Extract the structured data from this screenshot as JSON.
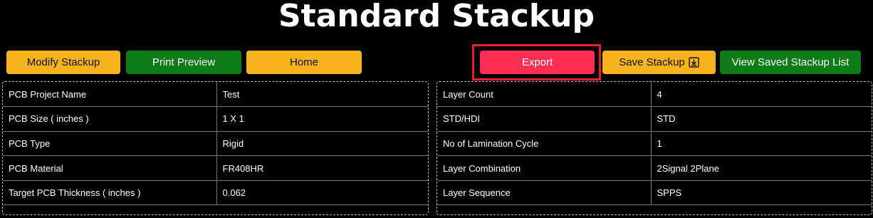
{
  "page_title": "Standard Stackup",
  "buttons": {
    "modify": "Modify Stackup",
    "print_preview": "Print Preview",
    "home": "Home",
    "export": "Export",
    "save": "Save Stackup",
    "view_saved": "View Saved Stackup List"
  },
  "colors": {
    "yellow": "#f5b31c",
    "green": "#0d7c16",
    "red": "#ff2e57",
    "highlight": "#e4202b"
  },
  "left_table": [
    {
      "label": "PCB Project Name",
      "value": "Test"
    },
    {
      "label": "PCB Size ( inches )",
      "value": "1 X 1"
    },
    {
      "label": "PCB Type",
      "value": "Rigid"
    },
    {
      "label": "PCB Material",
      "value": "FR408HR"
    },
    {
      "label": "Target PCB Thickness ( inches )",
      "value": "0.062"
    }
  ],
  "right_table": [
    {
      "label": "Layer Count",
      "value": "4"
    },
    {
      "label": "STD/HDI",
      "value": "STD"
    },
    {
      "label": "No of Lamination Cycle",
      "value": "1"
    },
    {
      "label": "Layer Combination",
      "value": "2Signal 2Plane"
    },
    {
      "label": "Layer Sequence",
      "value": "SPPS"
    }
  ]
}
